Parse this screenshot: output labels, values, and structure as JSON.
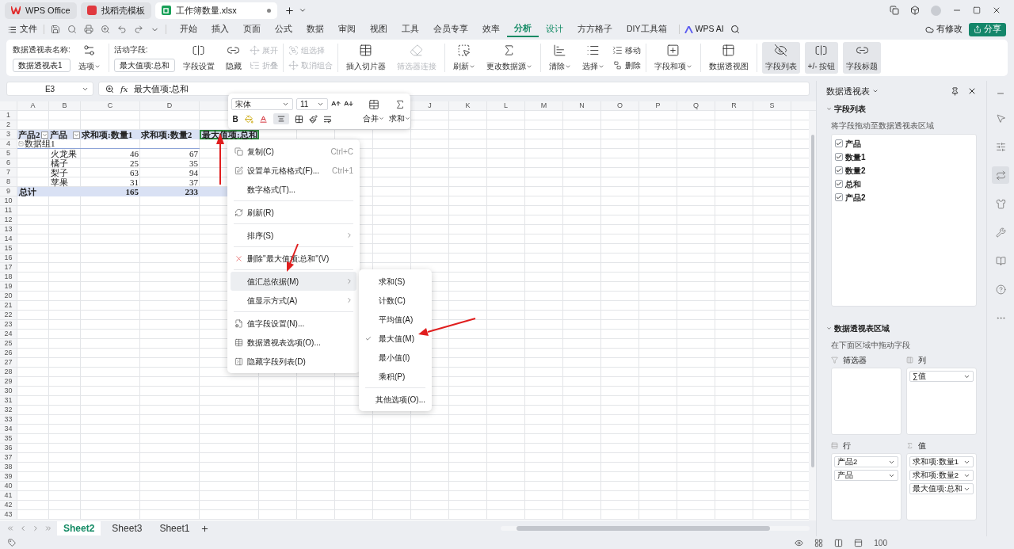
{
  "title_tabs": [
    {
      "label": "WPS Office",
      "selected": false,
      "kind": "wps"
    },
    {
      "label": "找稻壳模板",
      "selected": false,
      "kind": "template"
    },
    {
      "label": "工作簿数量.xlsx",
      "selected": true,
      "kind": "sheet"
    }
  ],
  "menu": {
    "file": "文件",
    "tabs": [
      {
        "label": "开始",
        "selected": false,
        "kind": "normal"
      },
      {
        "label": "插入",
        "selected": false,
        "kind": "normal"
      },
      {
        "label": "页面",
        "selected": false,
        "kind": "normal"
      },
      {
        "label": "公式",
        "selected": false,
        "kind": "normal"
      },
      {
        "label": "数据",
        "selected": false,
        "kind": "normal"
      },
      {
        "label": "审阅",
        "selected": false,
        "kind": "normal"
      },
      {
        "label": "视图",
        "selected": false,
        "kind": "normal"
      },
      {
        "label": "工具",
        "selected": false,
        "kind": "normal"
      },
      {
        "label": "会员专享",
        "selected": false,
        "kind": "normal"
      },
      {
        "label": "效率",
        "selected": false,
        "kind": "normal"
      },
      {
        "label": "分析",
        "selected": true,
        "kind": "context"
      },
      {
        "label": "设计",
        "selected": false,
        "kind": "context"
      },
      {
        "label": "方方格子",
        "selected": false,
        "kind": "normal"
      },
      {
        "label": "DIY工具箱",
        "selected": false,
        "kind": "normal"
      }
    ],
    "ai": "WPS AI",
    "changes": "有修改",
    "share": "分享"
  },
  "ribbon": {
    "groups": [
      {
        "items": [
          {
            "kind": "field",
            "label": "数据透视表名称:",
            "value": "数据透视表1"
          },
          {
            "kind": "big",
            "label": "选项",
            "dropdown": true,
            "disabled": false,
            "on": false
          }
        ]
      },
      {
        "items": [
          {
            "kind": "field",
            "label": "活动字段:",
            "value": "最大值项:总和"
          },
          {
            "kind": "big",
            "label": "字段设置",
            "dropdown": false,
            "disabled": false,
            "on": false
          },
          {
            "kind": "big",
            "label": "隐藏",
            "dropdown": false,
            "disabled": false,
            "on": false
          },
          {
            "kind": "stack",
            "items": [
              {
                "label": "展开",
                "disabled": true
              },
              {
                "label": "折叠",
                "disabled": true
              }
            ]
          }
        ]
      },
      {
        "items": [
          {
            "kind": "stack",
            "items": [
              {
                "label": "组选择",
                "disabled": true
              },
              {
                "label": "取消组合",
                "disabled": true
              }
            ]
          }
        ]
      },
      {
        "items": [
          {
            "kind": "big",
            "label": "插入切片器",
            "dropdown": false,
            "disabled": false,
            "on": false
          },
          {
            "kind": "big",
            "label": "筛选器连接",
            "dropdown": false,
            "disabled": true,
            "on": false
          }
        ]
      },
      {
        "items": [
          {
            "kind": "big",
            "label": "刷新",
            "dropdown": true,
            "disabled": false,
            "on": false
          },
          {
            "kind": "big",
            "label": "更改数据源",
            "dropdown": true,
            "disabled": false,
            "on": false
          }
        ]
      },
      {
        "items": [
          {
            "kind": "big",
            "label": "清除",
            "dropdown": true,
            "disabled": false,
            "on": false
          },
          {
            "kind": "big",
            "label": "选择",
            "dropdown": true,
            "disabled": false,
            "on": false
          },
          {
            "kind": "stack",
            "items": [
              {
                "label": "移动",
                "disabled": false
              },
              {
                "label": "删除",
                "disabled": false
              }
            ]
          }
        ]
      },
      {
        "items": [
          {
            "kind": "big",
            "label": "字段和项",
            "dropdown": true,
            "disabled": false,
            "on": false
          }
        ]
      },
      {
        "items": [
          {
            "kind": "big",
            "label": "数据透视图",
            "dropdown": false,
            "disabled": false,
            "on": false
          }
        ]
      },
      {
        "items": [
          {
            "kind": "big",
            "label": "字段列表",
            "dropdown": false,
            "disabled": false,
            "on": true
          },
          {
            "kind": "big",
            "label": "+/- 按钮",
            "dropdown": false,
            "disabled": false,
            "on": true
          },
          {
            "kind": "big",
            "label": "字段标题",
            "dropdown": false,
            "disabled": false,
            "on": true
          }
        ]
      }
    ]
  },
  "formula_bar": {
    "cell": "E3",
    "fx": "fx",
    "content": "最大值项:总和"
  },
  "columns": [
    "A",
    "B",
    "C",
    "D",
    "J",
    "K",
    "L",
    "M",
    "N",
    "O",
    "P",
    "Q",
    "R",
    "S"
  ],
  "rows": [
    {
      "num": "1",
      "kind": "empty"
    },
    {
      "num": "2",
      "kind": "empty"
    },
    {
      "num": "3",
      "kind": "header",
      "cells": [
        {
          "text": "产品2",
          "filter": true,
          "selected": false
        },
        {
          "text": "产品",
          "filter": true,
          "selected": false
        },
        {
          "text": "求和项:数量1",
          "filter": false,
          "selected": false
        },
        {
          "text": "求和项:数量2",
          "filter": false,
          "selected": false
        },
        {
          "text": "最大值项:总和",
          "filter": false,
          "selected": true
        }
      ]
    },
    {
      "num": "4",
      "kind": "group",
      "label": "数据组1"
    },
    {
      "num": "5",
      "kind": "item",
      "label": "火龙果",
      "values": [
        "46",
        "67"
      ]
    },
    {
      "num": "6",
      "kind": "item",
      "label": "橘子",
      "values": [
        "25",
        "35"
      ]
    },
    {
      "num": "7",
      "kind": "item",
      "label": "梨子",
      "values": [
        "63",
        "94"
      ]
    },
    {
      "num": "8",
      "kind": "item",
      "label": "苹果",
      "values": [
        "31",
        "37"
      ]
    },
    {
      "num": "9",
      "kind": "total",
      "label": "总计",
      "values": [
        "165",
        "233"
      ]
    },
    {
      "num": "10",
      "kind": "empty"
    },
    {
      "num": "11",
      "kind": "empty"
    },
    {
      "num": "12",
      "kind": "empty"
    },
    {
      "num": "13",
      "kind": "empty"
    },
    {
      "num": "14",
      "kind": "empty"
    },
    {
      "num": "15",
      "kind": "empty"
    },
    {
      "num": "16",
      "kind": "empty"
    },
    {
      "num": "17",
      "kind": "empty"
    },
    {
      "num": "18",
      "kind": "empty"
    },
    {
      "num": "19",
      "kind": "empty"
    },
    {
      "num": "20",
      "kind": "empty"
    },
    {
      "num": "21",
      "kind": "empty"
    },
    {
      "num": "22",
      "kind": "empty"
    },
    {
      "num": "23",
      "kind": "empty"
    },
    {
      "num": "24",
      "kind": "empty"
    },
    {
      "num": "25",
      "kind": "empty"
    },
    {
      "num": "26",
      "kind": "empty"
    },
    {
      "num": "27",
      "kind": "empty"
    },
    {
      "num": "28",
      "kind": "empty"
    },
    {
      "num": "29",
      "kind": "empty"
    },
    {
      "num": "30",
      "kind": "empty"
    },
    {
      "num": "31",
      "kind": "empty"
    },
    {
      "num": "32",
      "kind": "empty"
    },
    {
      "num": "33",
      "kind": "empty"
    },
    {
      "num": "34",
      "kind": "empty"
    },
    {
      "num": "35",
      "kind": "empty"
    },
    {
      "num": "36",
      "kind": "empty"
    },
    {
      "num": "37",
      "kind": "empty"
    },
    {
      "num": "38",
      "kind": "empty"
    },
    {
      "num": "39",
      "kind": "empty"
    },
    {
      "num": "40",
      "kind": "empty"
    },
    {
      "num": "41",
      "kind": "empty"
    },
    {
      "num": "42",
      "kind": "empty"
    },
    {
      "num": "43",
      "kind": "empty"
    }
  ],
  "mini_toolbar": {
    "font": "宋体",
    "size": "11",
    "bold": "B",
    "merge": "合并",
    "sum": "求和"
  },
  "context_menu": {
    "items": [
      {
        "kind": "item",
        "label": "复制(C)",
        "shortcut": "Ctrl+C",
        "submenu": false,
        "highlighted": false
      },
      {
        "kind": "item",
        "label": "设置单元格格式(F)...",
        "shortcut": "Ctrl+1",
        "submenu": false,
        "highlighted": false
      },
      {
        "kind": "item",
        "label": "数字格式(T)...",
        "submenu": false,
        "highlighted": false
      },
      {
        "kind": "divider"
      },
      {
        "kind": "item",
        "label": "刷新(R)",
        "submenu": false,
        "highlighted": false
      },
      {
        "kind": "divider"
      },
      {
        "kind": "item",
        "label": "排序(S)",
        "submenu": true,
        "highlighted": false
      },
      {
        "kind": "divider"
      },
      {
        "kind": "item",
        "label": "删除\"最大值项:总和\"(V)",
        "submenu": false,
        "highlighted": false
      },
      {
        "kind": "divider"
      },
      {
        "kind": "item",
        "label": "值汇总依据(M)",
        "submenu": true,
        "highlighted": true
      },
      {
        "kind": "item",
        "label": "值显示方式(A)",
        "submenu": true,
        "highlighted": false
      },
      {
        "kind": "divider"
      },
      {
        "kind": "item",
        "label": "值字段设置(N)...",
        "submenu": false,
        "highlighted": false
      },
      {
        "kind": "item",
        "label": "数据透视表选项(O)...",
        "submenu": false,
        "highlighted": false
      },
      {
        "kind": "item",
        "label": "隐藏字段列表(D)",
        "submenu": false,
        "highlighted": false
      }
    ]
  },
  "submenu": {
    "items": [
      {
        "kind": "item",
        "label": "求和(S)",
        "checked": false
      },
      {
        "kind": "item",
        "label": "计数(C)",
        "checked": false
      },
      {
        "kind": "item",
        "label": "平均值(A)",
        "checked": false
      },
      {
        "kind": "item",
        "label": "最大值(M)",
        "checked": true
      },
      {
        "kind": "item",
        "label": "最小值(I)",
        "checked": false
      },
      {
        "kind": "item",
        "label": "乘积(P)",
        "checked": false
      },
      {
        "kind": "divider"
      },
      {
        "kind": "item",
        "label": "其他选项(O)...",
        "checked": false
      }
    ]
  },
  "panel": {
    "title": "数据透视表",
    "fields_heading": "字段列表",
    "fields_hint": "将字段拖动至数据透视表区域",
    "fields": [
      {
        "label": "产品",
        "checked": true
      },
      {
        "label": "数量1",
        "checked": true
      },
      {
        "label": "数量2",
        "checked": true
      },
      {
        "label": "总和",
        "checked": true
      },
      {
        "label": "产品2",
        "checked": true
      }
    ],
    "areas_heading": "数据透视表区域",
    "areas_hint": "在下面区域中拖动字段",
    "areas": [
      {
        "label": "筛选器",
        "kind": "filter"
      },
      {
        "label": "列",
        "kind": "column",
        "items": [
          "∑值"
        ]
      },
      {
        "label": "行",
        "kind": "row",
        "items": [
          "产品2",
          "产品"
        ]
      },
      {
        "label": "值",
        "kind": "value",
        "items": [
          "求和项:数量1",
          "求和项:数量2",
          "最大值项:总和"
        ]
      }
    ]
  },
  "sheets": [
    {
      "label": "Sheet2",
      "selected": true
    },
    {
      "label": "Sheet3",
      "selected": false
    },
    {
      "label": "Sheet1",
      "selected": false
    }
  ],
  "status": {
    "zoom": "100"
  }
}
